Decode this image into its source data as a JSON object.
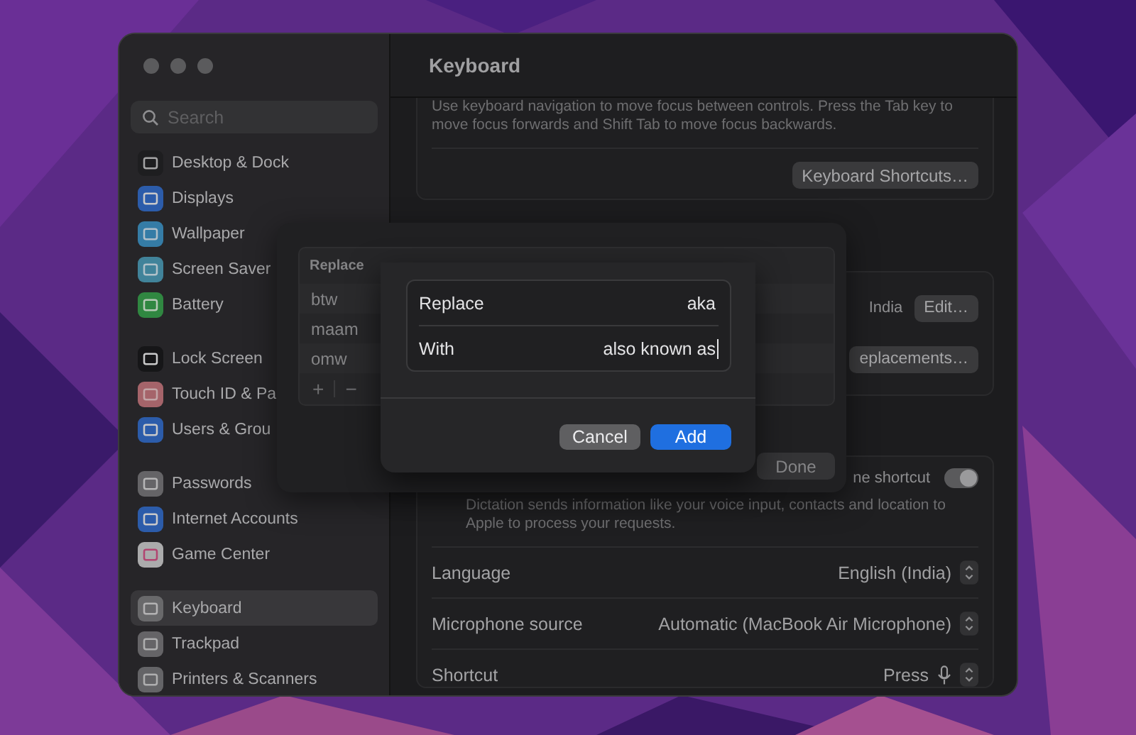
{
  "sidebar": {
    "search": {
      "placeholder": "Search"
    },
    "groups": [
      [
        {
          "label": "Desktop & Dock",
          "selected": false
        },
        {
          "label": "Displays",
          "selected": false
        },
        {
          "label": "Wallpaper",
          "selected": false
        },
        {
          "label": "Screen Saver",
          "selected": false
        },
        {
          "label": "Battery",
          "selected": false
        }
      ],
      [
        {
          "label": "Lock Screen",
          "selected": false
        },
        {
          "label": "Touch ID & Pa",
          "selected": false
        },
        {
          "label": "Users & Grou",
          "selected": false
        }
      ],
      [
        {
          "label": "Passwords",
          "selected": false
        },
        {
          "label": "Internet Accounts",
          "selected": false
        },
        {
          "label": "Game Center",
          "selected": false
        }
      ],
      [
        {
          "label": "Keyboard",
          "selected": true
        },
        {
          "label": "Trackpad",
          "selected": false
        },
        {
          "label": "Printers & Scanners",
          "selected": false
        }
      ]
    ]
  },
  "content": {
    "title": "Keyboard",
    "navigation_note": "Use keyboard navigation to move focus between controls. Press the Tab key to move focus forwards and Shift Tab to move focus backwards.",
    "shortcuts_button": "Keyboard Shortcuts…",
    "input_sources": {
      "value": "India",
      "button": "Edit…"
    },
    "text_replacements_button": "eplacements…",
    "dictation": {
      "label": "ne shortcut",
      "on": true,
      "note": "Dictation sends information like your voice input, contacts and location to Apple to process your requests."
    },
    "rows": [
      {
        "label": "Language",
        "value": "English (India)",
        "kind": "text"
      },
      {
        "label": "Microphone source",
        "value": "Automatic (MacBook Air Microphone)",
        "kind": "text"
      },
      {
        "label": "Shortcut",
        "value": "Press",
        "kind": "mic"
      }
    ]
  },
  "replacements_sheet": {
    "column": "Replace",
    "rows": [
      "btw",
      "maam",
      "omw"
    ],
    "add": "+",
    "remove": "−",
    "done": "Done"
  },
  "add_dialog": {
    "fields": [
      {
        "label": "Replace",
        "value": "aka",
        "focused": false
      },
      {
        "label": "With",
        "value": "also known as",
        "focused": true
      }
    ],
    "cancel": "Cancel",
    "add": "Add"
  }
}
